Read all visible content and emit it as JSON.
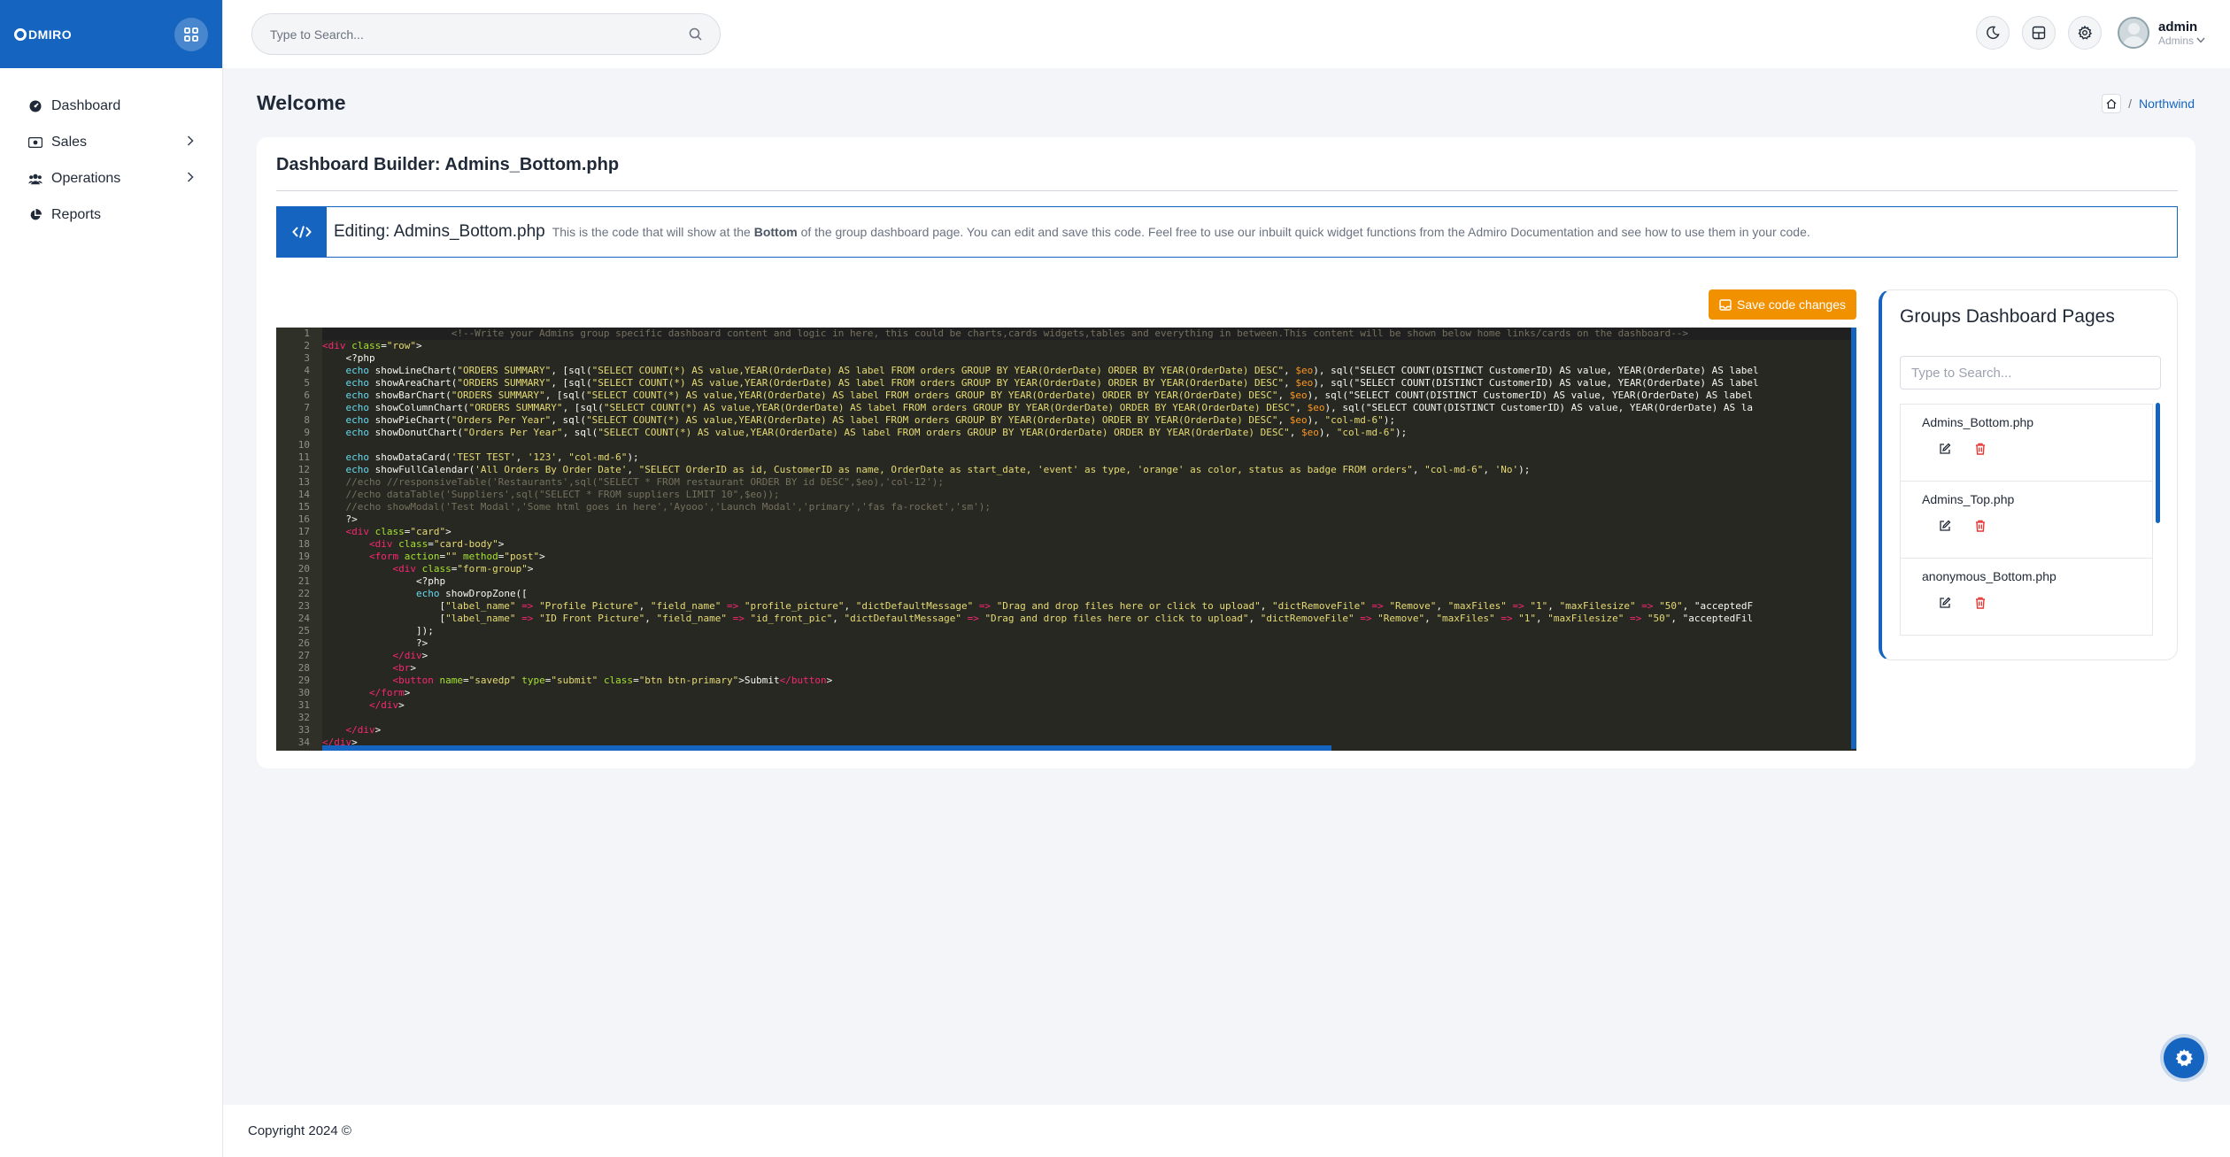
{
  "app": {
    "logo_text": "DMIRO"
  },
  "search": {
    "placeholder": "Type to Search..."
  },
  "sidebar": {
    "items": [
      {
        "label": "Dashboard",
        "icon": "dashboard-icon"
      },
      {
        "label": "Sales",
        "icon": "cash-icon"
      },
      {
        "label": "Operations",
        "icon": "users-icon"
      },
      {
        "label": "Reports",
        "icon": "pie-chart-icon"
      }
    ]
  },
  "user": {
    "name": "admin",
    "role": "Admins"
  },
  "page": {
    "title": "Welcome"
  },
  "breadcrumb": {
    "current": "Northwind"
  },
  "builder": {
    "title": "Dashboard Builder: Admins_Bottom.php",
    "alert_title": "Editing: Admins_Bottom.php",
    "alert_text_1": "This is the code that will show at the",
    "alert_text_bold": "Bottom",
    "alert_text_2": "of the group dashboard page. You can edit and save this code. Feel free to use our inbuilt quick widget functions from the Admiro Documentation and see how to use them in your code.",
    "save_label": "Save code changes"
  },
  "editor": {
    "line_numbers": [
      "1",
      "2",
      "3",
      "4",
      "5",
      "6",
      "7",
      "8",
      "9",
      "10",
      "11",
      "12",
      "13",
      "14",
      "15",
      "16",
      "17",
      "18",
      "19",
      "20",
      "21",
      "22",
      "23",
      "24",
      "25",
      "26",
      "27",
      "28",
      "29",
      "30",
      "31",
      "32",
      "33",
      "34"
    ],
    "lines": [
      "                      <!--Write your Admins group specific dashboard content and logic in here, this could be charts,cards widgets,tables and everything in between.This content will be shown below home links/cards on the dashboard-->",
      "<div class=\"row\">",
      "    <?php",
      "    echo showLineChart(\"ORDERS SUMMARY\", [sql(\"SELECT COUNT(*) AS value,YEAR(OrderDate) AS label FROM orders GROUP BY YEAR(OrderDate) ORDER BY YEAR(OrderDate) DESC\", $eo), sql(\"SELECT COUNT(DISTINCT CustomerID) AS value, YEAR(OrderDate) AS label",
      "    echo showAreaChart(\"ORDERS SUMMARY\", [sql(\"SELECT COUNT(*) AS value,YEAR(OrderDate) AS label FROM orders GROUP BY YEAR(OrderDate) ORDER BY YEAR(OrderDate) DESC\", $eo), sql(\"SELECT COUNT(DISTINCT CustomerID) AS value, YEAR(OrderDate) AS label",
      "    echo showBarChart(\"ORDERS SUMMARY\", [sql(\"SELECT COUNT(*) AS value,YEAR(OrderDate) AS label FROM orders GROUP BY YEAR(OrderDate) ORDER BY YEAR(OrderDate) DESC\", $eo), sql(\"SELECT COUNT(DISTINCT CustomerID) AS value, YEAR(OrderDate) AS label",
      "    echo showColumnChart(\"ORDERS SUMMARY\", [sql(\"SELECT COUNT(*) AS value,YEAR(OrderDate) AS label FROM orders GROUP BY YEAR(OrderDate) ORDER BY YEAR(OrderDate) DESC\", $eo), sql(\"SELECT COUNT(DISTINCT CustomerID) AS value, YEAR(OrderDate) AS la",
      "    echo showPieChart(\"Orders Per Year\", sql(\"SELECT COUNT(*) AS value,YEAR(OrderDate) AS label FROM orders GROUP BY YEAR(OrderDate) ORDER BY YEAR(OrderDate) DESC\", $eo), \"col-md-6\");",
      "    echo showDonutChart(\"Orders Per Year\", sql(\"SELECT COUNT(*) AS value,YEAR(OrderDate) AS label FROM orders GROUP BY YEAR(OrderDate) ORDER BY YEAR(OrderDate) DESC\", $eo), \"col-md-6\");",
      "",
      "    echo showDataCard('TEST TEST', '123', \"col-md-6\");",
      "    echo showFullCalendar('All Orders By Order Date', \"SELECT OrderID as id, CustomerID as name, OrderDate as start_date, 'event' as type, 'orange' as color, status as badge FROM orders\", \"col-md-6\", 'No');",
      "    //echo //responsiveTable('Restaurants',sql(\"SELECT * FROM restaurant ORDER BY id DESC\",$eo),'col-12');",
      "    //echo dataTable('Suppliers',sql(\"SELECT * FROM suppliers LIMIT 10\",$eo));",
      "    //echo showModal('Test Modal','Some html goes in here','Ayooo','Launch Modal','primary','fas fa-rocket','sm');",
      "    ?>",
      "    <div class=\"card\">",
      "        <div class=\"card-body\">",
      "        <form action=\"\" method=\"post\">",
      "            <div class=\"form-group\">",
      "                <?php",
      "                echo showDropZone([",
      "                    [\"label_name\" => \"Profile Picture\", \"field_name\" => \"profile_picture\", \"dictDefaultMessage\" => \"Drag and drop files here or click to upload\", \"dictRemoveFile\" => \"Remove\", \"maxFiles\" => \"1\", \"maxFilesize\" => \"50\", \"acceptedF",
      "                    [\"label_name\" => \"ID Front Picture\", \"field_name\" => \"id_front_pic\", \"dictDefaultMessage\" => \"Drag and drop files here or click to upload\", \"dictRemoveFile\" => \"Remove\", \"maxFiles\" => \"1\", \"maxFilesize\" => \"50\", \"acceptedFil",
      "                ]);",
      "                ?>",
      "            </div>",
      "            <br>",
      "            <button name=\"savedp\" type=\"submit\" class=\"btn btn-primary\">Submit</button>",
      "        </form>",
      "        </div>",
      "",
      "    </div>",
      "</div>"
    ]
  },
  "pages_panel": {
    "title": "Groups Dashboard Pages",
    "search_placeholder": "Type to Search...",
    "items": [
      {
        "name": "Admins_Bottom.php"
      },
      {
        "name": "Admins_Top.php"
      },
      {
        "name": "anonymous_Bottom.php"
      }
    ]
  },
  "footer": {
    "text": "Copyright 2024 ©"
  },
  "colors": {
    "primary": "#1565c0",
    "accent": "#f29100",
    "danger": "#e53935",
    "editor_bg": "#272822"
  }
}
